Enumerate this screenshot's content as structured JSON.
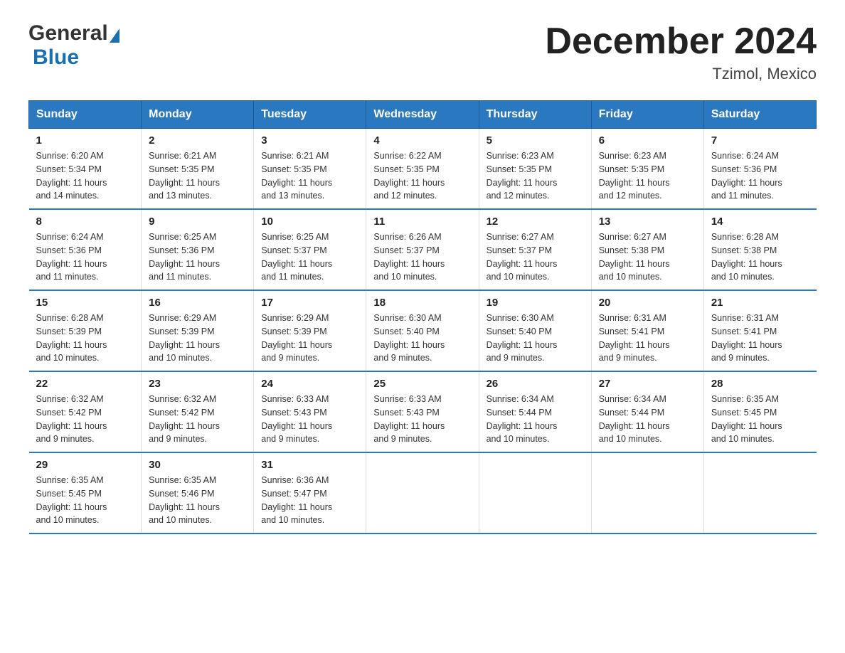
{
  "header": {
    "logo_general": "General",
    "logo_blue": "Blue",
    "month_title": "December 2024",
    "location": "Tzimol, Mexico"
  },
  "weekdays": [
    "Sunday",
    "Monday",
    "Tuesday",
    "Wednesday",
    "Thursday",
    "Friday",
    "Saturday"
  ],
  "weeks": [
    [
      {
        "day": "1",
        "sunrise": "6:20 AM",
        "sunset": "5:34 PM",
        "daylight": "11 hours and 14 minutes."
      },
      {
        "day": "2",
        "sunrise": "6:21 AM",
        "sunset": "5:35 PM",
        "daylight": "11 hours and 13 minutes."
      },
      {
        "day": "3",
        "sunrise": "6:21 AM",
        "sunset": "5:35 PM",
        "daylight": "11 hours and 13 minutes."
      },
      {
        "day": "4",
        "sunrise": "6:22 AM",
        "sunset": "5:35 PM",
        "daylight": "11 hours and 12 minutes."
      },
      {
        "day": "5",
        "sunrise": "6:23 AM",
        "sunset": "5:35 PM",
        "daylight": "11 hours and 12 minutes."
      },
      {
        "day": "6",
        "sunrise": "6:23 AM",
        "sunset": "5:35 PM",
        "daylight": "11 hours and 12 minutes."
      },
      {
        "day": "7",
        "sunrise": "6:24 AM",
        "sunset": "5:36 PM",
        "daylight": "11 hours and 11 minutes."
      }
    ],
    [
      {
        "day": "8",
        "sunrise": "6:24 AM",
        "sunset": "5:36 PM",
        "daylight": "11 hours and 11 minutes."
      },
      {
        "day": "9",
        "sunrise": "6:25 AM",
        "sunset": "5:36 PM",
        "daylight": "11 hours and 11 minutes."
      },
      {
        "day": "10",
        "sunrise": "6:25 AM",
        "sunset": "5:37 PM",
        "daylight": "11 hours and 11 minutes."
      },
      {
        "day": "11",
        "sunrise": "6:26 AM",
        "sunset": "5:37 PM",
        "daylight": "11 hours and 10 minutes."
      },
      {
        "day": "12",
        "sunrise": "6:27 AM",
        "sunset": "5:37 PM",
        "daylight": "11 hours and 10 minutes."
      },
      {
        "day": "13",
        "sunrise": "6:27 AM",
        "sunset": "5:38 PM",
        "daylight": "11 hours and 10 minutes."
      },
      {
        "day": "14",
        "sunrise": "6:28 AM",
        "sunset": "5:38 PM",
        "daylight": "11 hours and 10 minutes."
      }
    ],
    [
      {
        "day": "15",
        "sunrise": "6:28 AM",
        "sunset": "5:39 PM",
        "daylight": "11 hours and 10 minutes."
      },
      {
        "day": "16",
        "sunrise": "6:29 AM",
        "sunset": "5:39 PM",
        "daylight": "11 hours and 10 minutes."
      },
      {
        "day": "17",
        "sunrise": "6:29 AM",
        "sunset": "5:39 PM",
        "daylight": "11 hours and 9 minutes."
      },
      {
        "day": "18",
        "sunrise": "6:30 AM",
        "sunset": "5:40 PM",
        "daylight": "11 hours and 9 minutes."
      },
      {
        "day": "19",
        "sunrise": "6:30 AM",
        "sunset": "5:40 PM",
        "daylight": "11 hours and 9 minutes."
      },
      {
        "day": "20",
        "sunrise": "6:31 AM",
        "sunset": "5:41 PM",
        "daylight": "11 hours and 9 minutes."
      },
      {
        "day": "21",
        "sunrise": "6:31 AM",
        "sunset": "5:41 PM",
        "daylight": "11 hours and 9 minutes."
      }
    ],
    [
      {
        "day": "22",
        "sunrise": "6:32 AM",
        "sunset": "5:42 PM",
        "daylight": "11 hours and 9 minutes."
      },
      {
        "day": "23",
        "sunrise": "6:32 AM",
        "sunset": "5:42 PM",
        "daylight": "11 hours and 9 minutes."
      },
      {
        "day": "24",
        "sunrise": "6:33 AM",
        "sunset": "5:43 PM",
        "daylight": "11 hours and 9 minutes."
      },
      {
        "day": "25",
        "sunrise": "6:33 AM",
        "sunset": "5:43 PM",
        "daylight": "11 hours and 9 minutes."
      },
      {
        "day": "26",
        "sunrise": "6:34 AM",
        "sunset": "5:44 PM",
        "daylight": "11 hours and 10 minutes."
      },
      {
        "day": "27",
        "sunrise": "6:34 AM",
        "sunset": "5:44 PM",
        "daylight": "11 hours and 10 minutes."
      },
      {
        "day": "28",
        "sunrise": "6:35 AM",
        "sunset": "5:45 PM",
        "daylight": "11 hours and 10 minutes."
      }
    ],
    [
      {
        "day": "29",
        "sunrise": "6:35 AM",
        "sunset": "5:45 PM",
        "daylight": "11 hours and 10 minutes."
      },
      {
        "day": "30",
        "sunrise": "6:35 AM",
        "sunset": "5:46 PM",
        "daylight": "11 hours and 10 minutes."
      },
      {
        "day": "31",
        "sunrise": "6:36 AM",
        "sunset": "5:47 PM",
        "daylight": "11 hours and 10 minutes."
      },
      null,
      null,
      null,
      null
    ]
  ],
  "labels": {
    "sunrise": "Sunrise:",
    "sunset": "Sunset:",
    "daylight": "Daylight:"
  }
}
